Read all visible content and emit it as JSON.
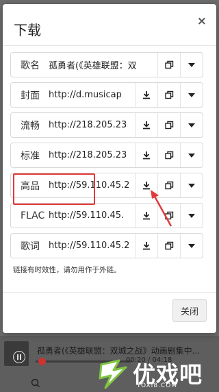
{
  "dialog": {
    "title": "下载",
    "close_symbol": "×",
    "note": "链接有时效性，请勿用作于外链。",
    "close_button": "关闭"
  },
  "rows": [
    {
      "label": "歌名",
      "value": "孤勇者(《英雄联盟：双",
      "has_download": false
    },
    {
      "label": "封面",
      "value": "http://d.musicap",
      "has_download": true
    },
    {
      "label": "流畅",
      "value": "http://218.205.23",
      "has_download": true
    },
    {
      "label": "标准",
      "value": "http://218.205.23",
      "has_download": true
    },
    {
      "label": "高品",
      "value": "http://59.110.45.2",
      "has_download": true
    },
    {
      "label": "FLAC",
      "value": "http://59.110.45.",
      "has_download": true
    },
    {
      "label": "歌词",
      "value": "http://59.110.45.2",
      "has_download": true
    }
  ],
  "icons": {
    "download": "download-icon",
    "copy": "copy-icon",
    "dropdown": "caret-down-icon"
  },
  "annotation": {
    "highlight_color": "#e23a3a",
    "highlight_target": "高品"
  },
  "player": {
    "song_title": "孤勇者(《英雄联盟：双城之战》动画剧集中...",
    "time": "00:20 / 04:18"
  },
  "watermark": {
    "brand": "优戏吧",
    "url": "YOXI8.COM"
  }
}
